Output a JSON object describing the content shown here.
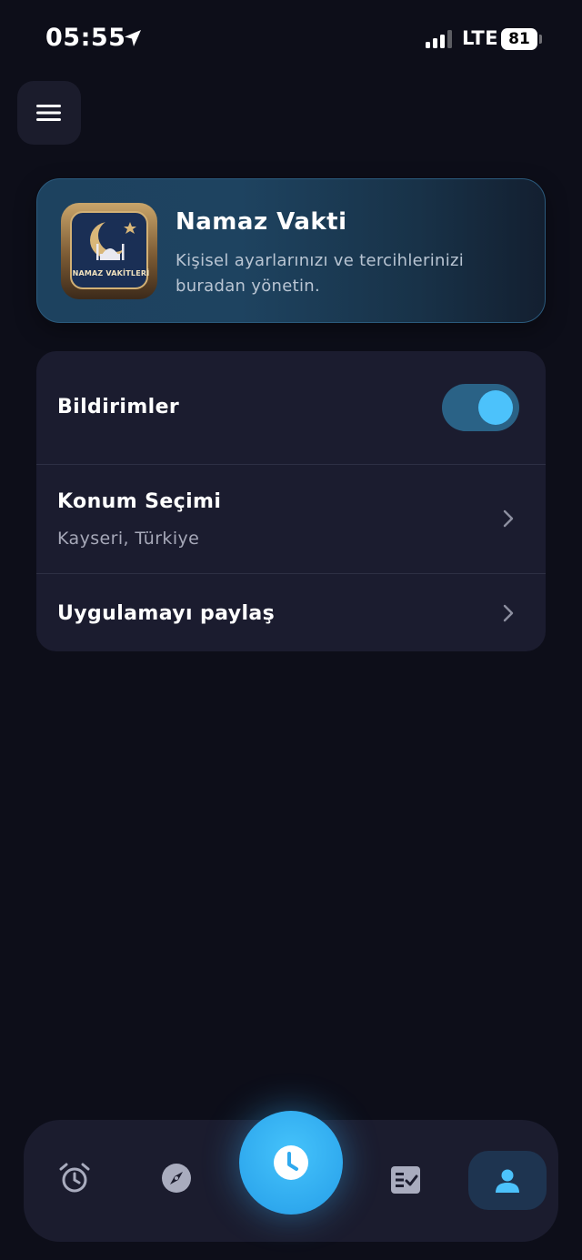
{
  "status_bar": {
    "time": "05:55",
    "network": "LTE",
    "battery": "81",
    "icons": [
      "location-arrow-icon",
      "signal-icon",
      "battery-icon"
    ]
  },
  "header": {
    "menu_icon": "hamburger-menu-icon"
  },
  "hero": {
    "logo_text": "NAMAZ VAKİTLERİ",
    "title": "Namaz Vakti",
    "subtitle": "Kişisel ayarlarınızı ve tercihlerinizi buradan yönetin."
  },
  "settings": {
    "notifications": {
      "label": "Bildirimler",
      "enabled": true
    },
    "location": {
      "label": "Konum Seçimi",
      "value": "Kayseri, Türkiye"
    },
    "share": {
      "label": "Uygulamayı paylaş"
    }
  },
  "bottom_nav": {
    "items": [
      {
        "icon": "alarm-clock-icon"
      },
      {
        "icon": "compass-icon"
      },
      {
        "icon": "clock-icon",
        "primary": true
      },
      {
        "icon": "checklist-icon"
      },
      {
        "icon": "profile-icon",
        "active": true
      }
    ]
  },
  "colors": {
    "background": "#0d0e19",
    "card": "#1b1c2f",
    "accent": "#4cc2fb",
    "toggle_track": "#2a6286",
    "muted_text": "#a6a8b8"
  }
}
